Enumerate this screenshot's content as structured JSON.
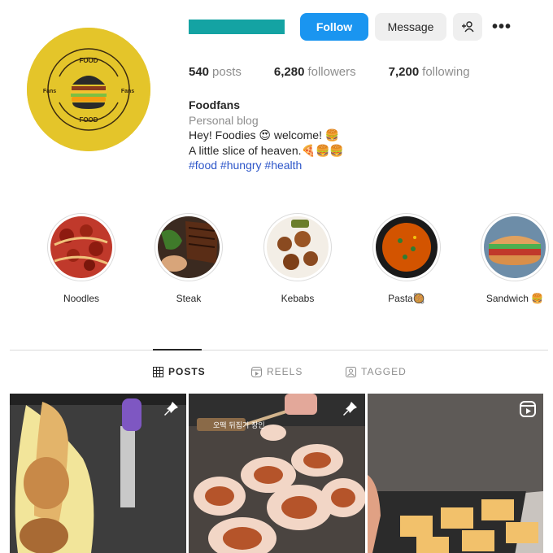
{
  "profile": {
    "follow_label": "Follow",
    "message_label": "Message",
    "more_label": "•••",
    "posts_count": "540",
    "posts_label": "posts",
    "followers_count": "6,280",
    "followers_label": "followers",
    "following_count": "7,200",
    "following_label": "following",
    "display_name": "Foodfans",
    "category": "Personal blog",
    "bio_line1": "Hey! Foodies 😍 welcome! 🍔",
    "bio_line2": "A little slice of heaven.🍕🍔🍔",
    "hashtags": "#food #hungry #health",
    "logo_text_top": "FOOD",
    "logo_text_bottom": "FOOD",
    "logo_text_left": "Fans",
    "logo_text_right": "Fans"
  },
  "highlights": [
    {
      "label": "Noodles"
    },
    {
      "label": "Steak"
    },
    {
      "label": "Kebabs"
    },
    {
      "label": "Pasta🥘"
    },
    {
      "label": "Sandwich 🍔"
    }
  ],
  "tabs": [
    {
      "label": "POSTS",
      "icon": "grid-icon"
    },
    {
      "label": "REELS",
      "icon": "reels-icon"
    },
    {
      "label": "TAGGED",
      "icon": "tagged-icon"
    }
  ],
  "posts": [
    {
      "pinned": true,
      "type": "image"
    },
    {
      "pinned": true,
      "type": "image",
      "overlay_text": "오떡 뒤집기 장인"
    },
    {
      "pinned": false,
      "type": "reel"
    }
  ],
  "colors": {
    "avatar_bg": "#e4c52a",
    "follow_button": "#1a95f0",
    "hashtag": "#2d56c9"
  }
}
